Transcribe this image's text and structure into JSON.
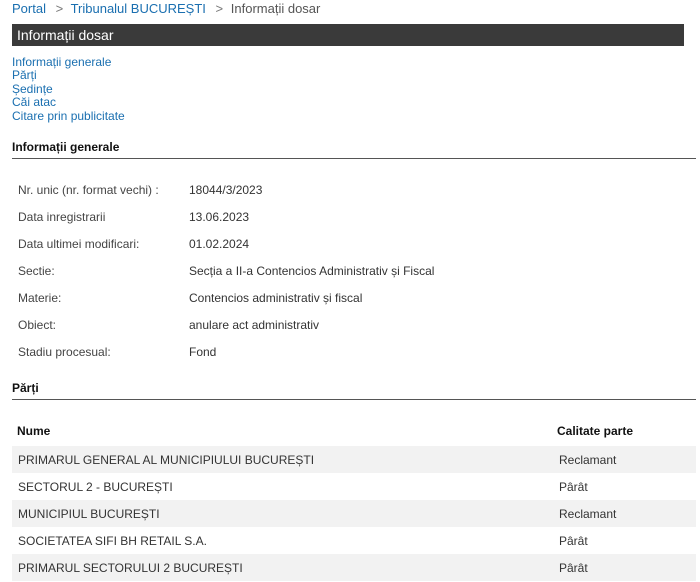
{
  "breadcrumb": {
    "portal": "Portal",
    "sep1": ">",
    "court": "Tribunalul BUCUREȘTI",
    "sep2": ">",
    "current": "Informații dosar"
  },
  "page_title": "Informații dosar",
  "nav": {
    "items": [
      "Informații generale",
      "Părți",
      "Ședințe",
      "Căi atac",
      "Citare prin publicitate"
    ]
  },
  "general": {
    "heading": "Informații generale",
    "fields": [
      {
        "label": "Nr. unic (nr. format vechi) :",
        "value": "18044/3/2023"
      },
      {
        "label": "Data inregistrarii",
        "value": "13.06.2023"
      },
      {
        "label": "Data ultimei modificari:",
        "value": "01.02.2024"
      },
      {
        "label": "Sectie:",
        "value": "Secția a II-a Contencios Administrativ și Fiscal"
      },
      {
        "label": "Materie:",
        "value": "Contencios administrativ și fiscal"
      },
      {
        "label": "Obiect:",
        "value": "anulare act administrativ"
      },
      {
        "label": "Stadiu procesual:",
        "value": "Fond"
      }
    ]
  },
  "parti": {
    "heading": "Părți",
    "columns": {
      "name": "Nume",
      "role": "Calitate parte"
    },
    "rows": [
      {
        "name": "PRIMARUL GENERAL AL MUNICIPIULUI BUCUREȘTI",
        "role": "Reclamant"
      },
      {
        "name": "SECTORUL 2 - BUCUREȘTI",
        "role": "Pârât"
      },
      {
        "name": "MUNICIPIUL BUCUREȘTI",
        "role": "Reclamant"
      },
      {
        "name": "SOCIETATEA SIFI BH RETAIL S.A.",
        "role": "Pârât"
      },
      {
        "name": "PRIMARUL SECTORULUI 2 BUCUREȘTI",
        "role": "Pârât"
      }
    ]
  }
}
